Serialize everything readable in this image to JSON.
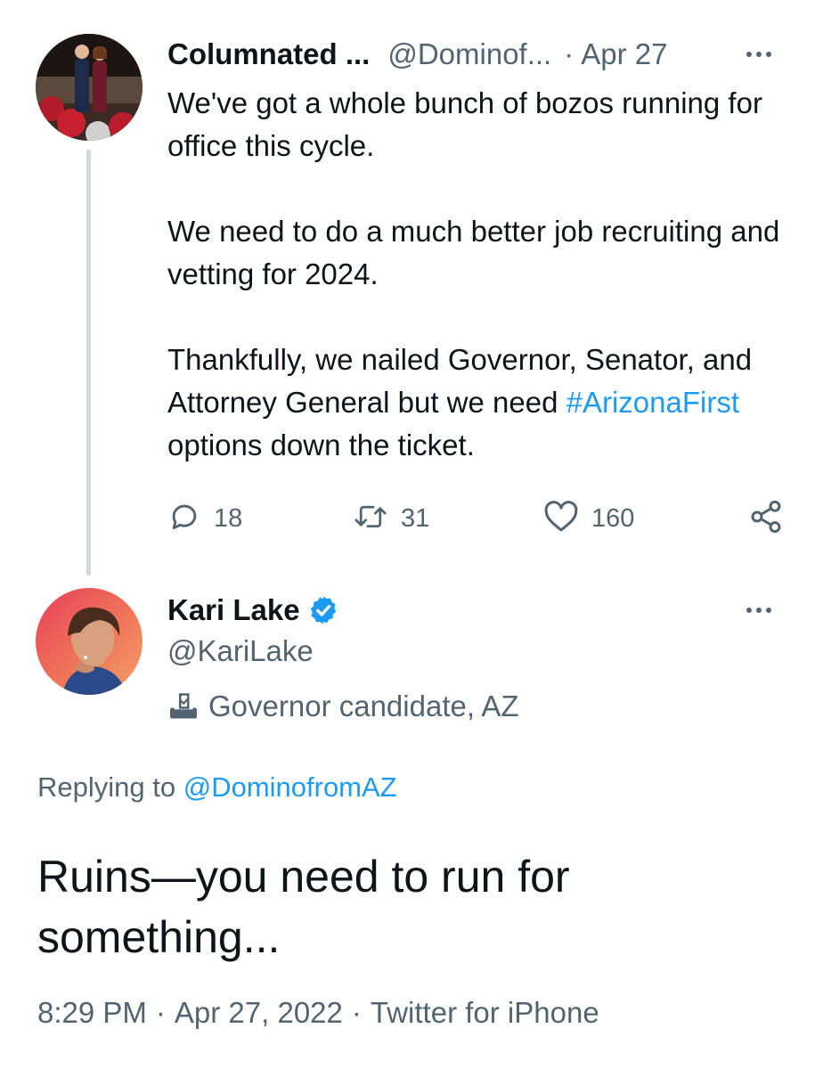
{
  "tweet": {
    "author_name": "Columnated ...",
    "author_handle": "@Dominof...",
    "separator": "·",
    "date": "Apr 27",
    "paragraphs": [
      "We've got a whole bunch of bozos running for office this cycle.",
      "We need to do a much better job recruiting and vetting for 2024.",
      "Thankfully, we nailed Governor, Senator, and Attorney General but we need"
    ],
    "hashtag": "#ArizonaFirst",
    "after_hashtag": " options down the ticket.",
    "actions": {
      "replies": "18",
      "retweets": "31",
      "likes": "160"
    }
  },
  "reply": {
    "author_name": "Kari Lake",
    "author_handle": "@KariLake",
    "label": "Governor candidate, AZ",
    "replying_prefix": "Replying to",
    "replying_to": "@DominofromAZ",
    "text": "Ruins—you need to run for something...",
    "time": "8:29 PM",
    "date": "Apr 27, 2022",
    "source": "Twitter for iPhone",
    "separator": "·"
  },
  "colors": {
    "accent": "#1d9bf0",
    "secondary_text": "#536471",
    "primary_text": "#0f1419",
    "thread_line": "#cfd9de"
  },
  "icons": [
    "reply-icon",
    "retweet-icon",
    "like-icon",
    "share-icon",
    "more-icon",
    "verified-badge-icon",
    "ballot-box-icon"
  ]
}
